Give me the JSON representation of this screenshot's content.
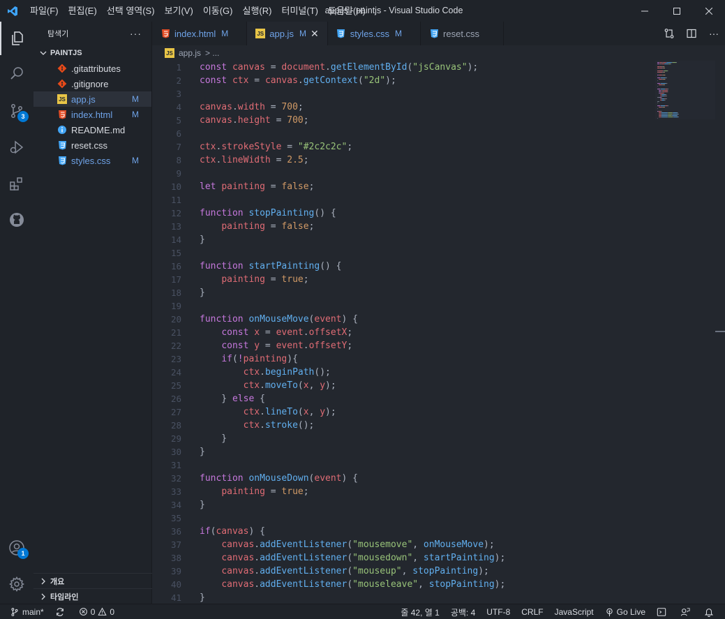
{
  "titlebar": {
    "menu": [
      "파일(F)",
      "편집(E)",
      "선택 영역(S)",
      "보기(V)",
      "이동(G)",
      "실행(R)",
      "터미널(T)",
      "도움말(H)"
    ],
    "window_title": "app.js - paintjs - Visual Studio Code"
  },
  "activitybar": {
    "source_control_badge": "3",
    "accounts_badge": "1"
  },
  "sidebar": {
    "title": "탐색기",
    "folder": "PAINTJS",
    "files": [
      {
        "name": ".gitattributes",
        "icon": "git-icon",
        "status": "",
        "color": "#d7dae0"
      },
      {
        "name": ".gitignore",
        "icon": "git-icon",
        "status": "",
        "color": "#d7dae0"
      },
      {
        "name": "app.js",
        "icon": "js-icon",
        "status": "M",
        "color": "#6fa3e8"
      },
      {
        "name": "index.html",
        "icon": "html-icon",
        "status": "M",
        "color": "#6fa3e8"
      },
      {
        "name": "README.md",
        "icon": "info-icon",
        "status": "",
        "color": "#d7dae0"
      },
      {
        "name": "reset.css",
        "icon": "css-icon",
        "status": "",
        "color": "#d7dae0"
      },
      {
        "name": "styles.css",
        "icon": "css-icon",
        "status": "M",
        "color": "#6fa3e8"
      }
    ],
    "outline_label": "개요",
    "timeline_label": "타임라인"
  },
  "tabs": [
    {
      "name": "index.html",
      "icon": "html-icon",
      "mark": "M",
      "active": false
    },
    {
      "name": "app.js",
      "icon": "js-icon",
      "mark": "M",
      "active": true
    },
    {
      "name": "styles.css",
      "icon": "css-icon",
      "mark": "M",
      "active": false
    },
    {
      "name": "reset.css",
      "icon": "css-icon",
      "mark": "",
      "active": false
    }
  ],
  "breadcrumb": {
    "file": "app.js",
    "separator": "> ..."
  },
  "code": [
    [
      [
        "t-kw",
        "const"
      ],
      [
        "t-plain",
        " "
      ],
      [
        "t-var",
        "canvas"
      ],
      [
        "t-plain",
        " = "
      ],
      [
        "t-var",
        "document"
      ],
      [
        "t-plain",
        "."
      ],
      [
        "t-fn",
        "getElementById"
      ],
      [
        "t-plain",
        "("
      ],
      [
        "t-str",
        "\"jsCanvas\""
      ],
      [
        "t-plain",
        ");"
      ]
    ],
    [
      [
        "t-kw",
        "const"
      ],
      [
        "t-plain",
        " "
      ],
      [
        "t-var",
        "ctx"
      ],
      [
        "t-plain",
        " = "
      ],
      [
        "t-var",
        "canvas"
      ],
      [
        "t-plain",
        "."
      ],
      [
        "t-fn",
        "getContext"
      ],
      [
        "t-plain",
        "("
      ],
      [
        "t-str",
        "\"2d\""
      ],
      [
        "t-plain",
        ");"
      ]
    ],
    [],
    [
      [
        "t-var",
        "canvas"
      ],
      [
        "t-plain",
        "."
      ],
      [
        "t-var",
        "width"
      ],
      [
        "t-plain",
        " = "
      ],
      [
        "t-num",
        "700"
      ],
      [
        "t-plain",
        ";"
      ]
    ],
    [
      [
        "t-var",
        "canvas"
      ],
      [
        "t-plain",
        "."
      ],
      [
        "t-var",
        "height"
      ],
      [
        "t-plain",
        " = "
      ],
      [
        "t-num",
        "700"
      ],
      [
        "t-plain",
        ";"
      ]
    ],
    [],
    [
      [
        "t-var",
        "ctx"
      ],
      [
        "t-plain",
        "."
      ],
      [
        "t-var",
        "strokeStyle"
      ],
      [
        "t-plain",
        " = "
      ],
      [
        "t-str",
        "\"#2c2c2c\""
      ],
      [
        "t-plain",
        ";"
      ]
    ],
    [
      [
        "t-var",
        "ctx"
      ],
      [
        "t-plain",
        "."
      ],
      [
        "t-var",
        "lineWidth"
      ],
      [
        "t-plain",
        " = "
      ],
      [
        "t-num",
        "2.5"
      ],
      [
        "t-plain",
        ";"
      ]
    ],
    [],
    [
      [
        "t-kw",
        "let"
      ],
      [
        "t-plain",
        " "
      ],
      [
        "t-var",
        "painting"
      ],
      [
        "t-plain",
        " = "
      ],
      [
        "t-bool",
        "false"
      ],
      [
        "t-plain",
        ";"
      ]
    ],
    [],
    [
      [
        "t-kw",
        "function"
      ],
      [
        "t-plain",
        " "
      ],
      [
        "t-fn",
        "stopPainting"
      ],
      [
        "t-plain",
        "() {"
      ]
    ],
    [
      [
        "t-plain",
        "    "
      ],
      [
        "t-var",
        "painting"
      ],
      [
        "t-plain",
        " = "
      ],
      [
        "t-bool",
        "false"
      ],
      [
        "t-plain",
        ";"
      ]
    ],
    [
      [
        "t-plain",
        "}"
      ]
    ],
    [],
    [
      [
        "t-kw",
        "function"
      ],
      [
        "t-plain",
        " "
      ],
      [
        "t-fn",
        "startPainting"
      ],
      [
        "t-plain",
        "() {"
      ]
    ],
    [
      [
        "t-plain",
        "    "
      ],
      [
        "t-var",
        "painting"
      ],
      [
        "t-plain",
        " = "
      ],
      [
        "t-bool",
        "true"
      ],
      [
        "t-plain",
        ";"
      ]
    ],
    [
      [
        "t-plain",
        "}"
      ]
    ],
    [],
    [
      [
        "t-kw",
        "function"
      ],
      [
        "t-plain",
        " "
      ],
      [
        "t-fn",
        "onMouseMove"
      ],
      [
        "t-plain",
        "("
      ],
      [
        "t-var",
        "event"
      ],
      [
        "t-plain",
        ") {"
      ]
    ],
    [
      [
        "t-plain",
        "    "
      ],
      [
        "t-kw",
        "const"
      ],
      [
        "t-plain",
        " "
      ],
      [
        "t-var",
        "x"
      ],
      [
        "t-plain",
        " = "
      ],
      [
        "t-var",
        "event"
      ],
      [
        "t-plain",
        "."
      ],
      [
        "t-var",
        "offsetX"
      ],
      [
        "t-plain",
        ";"
      ]
    ],
    [
      [
        "t-plain",
        "    "
      ],
      [
        "t-kw",
        "const"
      ],
      [
        "t-plain",
        " "
      ],
      [
        "t-var",
        "y"
      ],
      [
        "t-plain",
        " = "
      ],
      [
        "t-var",
        "event"
      ],
      [
        "t-plain",
        "."
      ],
      [
        "t-var",
        "offsetY"
      ],
      [
        "t-plain",
        ";"
      ]
    ],
    [
      [
        "t-plain",
        "    "
      ],
      [
        "t-kw",
        "if"
      ],
      [
        "t-plain",
        "("
      ],
      [
        "t-kw",
        "!"
      ],
      [
        "t-var",
        "painting"
      ],
      [
        "t-plain",
        "){"
      ]
    ],
    [
      [
        "t-plain",
        "        "
      ],
      [
        "t-var",
        "ctx"
      ],
      [
        "t-plain",
        "."
      ],
      [
        "t-fn",
        "beginPath"
      ],
      [
        "t-plain",
        "();"
      ]
    ],
    [
      [
        "t-plain",
        "        "
      ],
      [
        "t-var",
        "ctx"
      ],
      [
        "t-plain",
        "."
      ],
      [
        "t-fn",
        "moveTo"
      ],
      [
        "t-plain",
        "("
      ],
      [
        "t-var",
        "x"
      ],
      [
        "t-plain",
        ", "
      ],
      [
        "t-var",
        "y"
      ],
      [
        "t-plain",
        ");"
      ]
    ],
    [
      [
        "t-plain",
        "    } "
      ],
      [
        "t-kw",
        "else"
      ],
      [
        "t-plain",
        " {"
      ]
    ],
    [
      [
        "t-plain",
        "        "
      ],
      [
        "t-var",
        "ctx"
      ],
      [
        "t-plain",
        "."
      ],
      [
        "t-fn",
        "lineTo"
      ],
      [
        "t-plain",
        "("
      ],
      [
        "t-var",
        "x"
      ],
      [
        "t-plain",
        ", "
      ],
      [
        "t-var",
        "y"
      ],
      [
        "t-plain",
        ");"
      ]
    ],
    [
      [
        "t-plain",
        "        "
      ],
      [
        "t-var",
        "ctx"
      ],
      [
        "t-plain",
        "."
      ],
      [
        "t-fn",
        "stroke"
      ],
      [
        "t-plain",
        "();"
      ]
    ],
    [
      [
        "t-plain",
        "    }"
      ]
    ],
    [
      [
        "t-plain",
        "}"
      ]
    ],
    [],
    [
      [
        "t-kw",
        "function"
      ],
      [
        "t-plain",
        " "
      ],
      [
        "t-fn",
        "onMouseDown"
      ],
      [
        "t-plain",
        "("
      ],
      [
        "t-var",
        "event"
      ],
      [
        "t-plain",
        ") {"
      ]
    ],
    [
      [
        "t-plain",
        "    "
      ],
      [
        "t-var",
        "painting"
      ],
      [
        "t-plain",
        " = "
      ],
      [
        "t-bool",
        "true"
      ],
      [
        "t-plain",
        ";"
      ]
    ],
    [
      [
        "t-plain",
        "}"
      ]
    ],
    [],
    [
      [
        "t-kw",
        "if"
      ],
      [
        "t-plain",
        "("
      ],
      [
        "t-var",
        "canvas"
      ],
      [
        "t-plain",
        ") {"
      ]
    ],
    [
      [
        "t-plain",
        "    "
      ],
      [
        "t-var",
        "canvas"
      ],
      [
        "t-plain",
        "."
      ],
      [
        "t-fn",
        "addEventListener"
      ],
      [
        "t-plain",
        "("
      ],
      [
        "t-str",
        "\"mousemove\""
      ],
      [
        "t-plain",
        ", "
      ],
      [
        "t-fn",
        "onMouseMove"
      ],
      [
        "t-plain",
        ");"
      ]
    ],
    [
      [
        "t-plain",
        "    "
      ],
      [
        "t-var",
        "canvas"
      ],
      [
        "t-plain",
        "."
      ],
      [
        "t-fn",
        "addEventListener"
      ],
      [
        "t-plain",
        "("
      ],
      [
        "t-str",
        "\"mousedown\""
      ],
      [
        "t-plain",
        ", "
      ],
      [
        "t-fn",
        "startPainting"
      ],
      [
        "t-plain",
        ");"
      ]
    ],
    [
      [
        "t-plain",
        "    "
      ],
      [
        "t-var",
        "canvas"
      ],
      [
        "t-plain",
        "."
      ],
      [
        "t-fn",
        "addEventListener"
      ],
      [
        "t-plain",
        "("
      ],
      [
        "t-str",
        "\"mouseup\""
      ],
      [
        "t-plain",
        ", "
      ],
      [
        "t-fn",
        "stopPainting"
      ],
      [
        "t-plain",
        ");"
      ]
    ],
    [
      [
        "t-plain",
        "    "
      ],
      [
        "t-var",
        "canvas"
      ],
      [
        "t-plain",
        "."
      ],
      [
        "t-fn",
        "addEventListener"
      ],
      [
        "t-plain",
        "("
      ],
      [
        "t-str",
        "\"mouseleave\""
      ],
      [
        "t-plain",
        ", "
      ],
      [
        "t-fn",
        "stopPainting"
      ],
      [
        "t-plain",
        ");"
      ]
    ],
    [
      [
        "t-plain",
        "}"
      ]
    ]
  ],
  "statusbar": {
    "branch": "main*",
    "errors": "0",
    "warnings": "0",
    "cursor": "줄 42, 열 1",
    "spaces": "공백: 4",
    "encoding": "UTF-8",
    "eol": "CRLF",
    "language": "JavaScript",
    "golive": "Go Live"
  },
  "colors": {
    "accent": "#0078d4",
    "modified": "#6fa3e8",
    "background": "#23272e"
  }
}
